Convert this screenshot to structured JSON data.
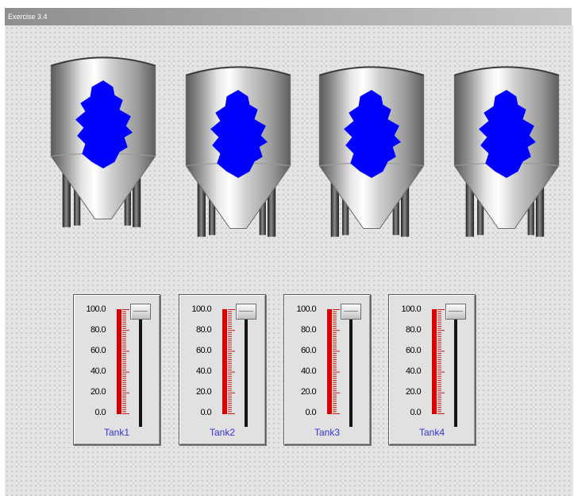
{
  "window": {
    "title": "Exercise 3.4"
  },
  "colors": {
    "liquid": "#0000ff",
    "level_bar": "#d80000",
    "label_text": "#3434d6"
  },
  "gauge": {
    "ticks": [
      "100.0",
      "80.0",
      "60.0",
      "40.0",
      "20.0",
      "0.0"
    ]
  },
  "tanks": [
    {
      "label": "Tank1",
      "level_percent": 100,
      "slider_percent": 100
    },
    {
      "label": "Tank2",
      "level_percent": 100,
      "slider_percent": 100
    },
    {
      "label": "Tank3",
      "level_percent": 100,
      "slider_percent": 100
    },
    {
      "label": "Tank4",
      "level_percent": 100,
      "slider_percent": 100
    }
  ]
}
